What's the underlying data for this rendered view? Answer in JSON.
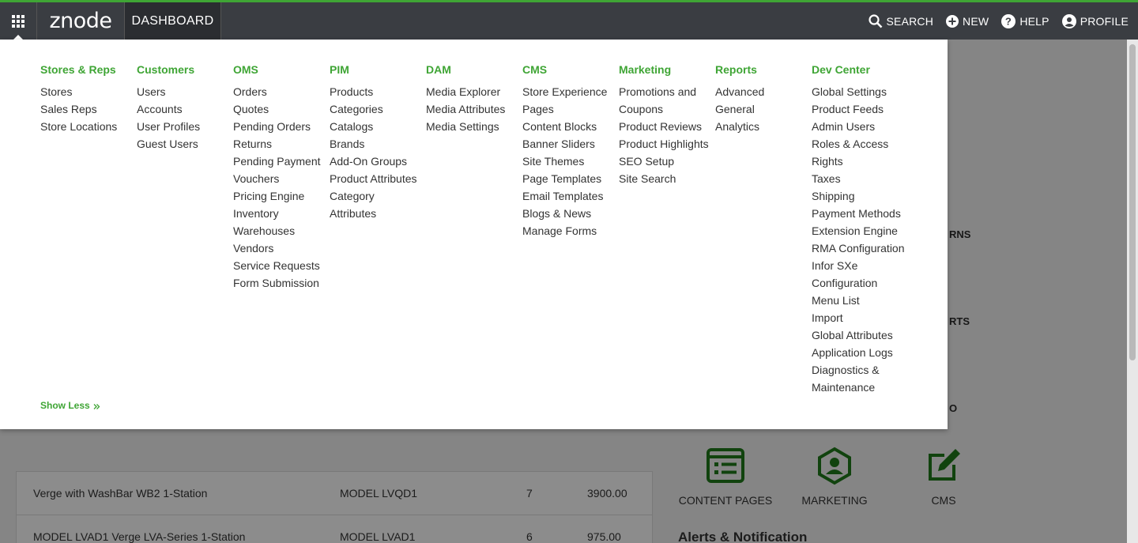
{
  "topbar": {
    "logo": "znode",
    "dashboard_tab": "DASHBOARD",
    "actions": {
      "search": "SEARCH",
      "new": "NEW",
      "help": "HELP",
      "profile": "PROFILE"
    }
  },
  "menu": {
    "columns": [
      {
        "title": "Stores & Reps",
        "items": [
          "Stores",
          "Sales Reps",
          "Store Locations"
        ]
      },
      {
        "title": "Customers",
        "items": [
          "Users",
          "Accounts",
          "User Profiles",
          "Guest Users"
        ]
      },
      {
        "title": "OMS",
        "items": [
          "Orders",
          "Quotes",
          "Pending Orders",
          "Returns",
          "Pending Payment",
          "Vouchers",
          "Pricing Engine",
          "Inventory",
          "Warehouses",
          "Vendors",
          "Service Requests",
          "Form Submission"
        ]
      },
      {
        "title": "PIM",
        "items": [
          "Products",
          "Categories",
          "Catalogs",
          "Brands",
          "Add-On Groups",
          "Product Attributes",
          "Category Attributes"
        ]
      },
      {
        "title": "DAM",
        "items": [
          "Media Explorer",
          "Media Attributes",
          "Media Settings"
        ]
      },
      {
        "title": "CMS",
        "items": [
          "Store Experience Pages",
          "Content Blocks",
          "Banner Sliders",
          "Site Themes",
          "Page Templates",
          "Email Templates",
          "Blogs & News",
          "Manage Forms"
        ]
      },
      {
        "title": "Marketing",
        "items": [
          "Promotions and Coupons",
          "Product Reviews",
          "Product Highlights",
          "SEO Setup",
          "Site Search"
        ]
      },
      {
        "title": "Reports",
        "items": [
          "Advanced General Analytics"
        ]
      },
      {
        "title": "Dev Center",
        "items": [
          "Global Settings",
          "Product Feeds",
          "Admin Users",
          "Roles & Access Rights",
          "Taxes",
          "Shipping",
          "Payment Methods",
          "Extension Engine",
          "RMA Configuration",
          "Infor SXe Configuration",
          "Menu List",
          "Import",
          "Global Attributes",
          "Application Logs",
          "Diagnostics & Maintenance"
        ]
      }
    ],
    "show_less": "Show Less"
  },
  "background": {
    "table_rows": [
      {
        "name": "Verge with WashBar WB2 1-Station",
        "model": "MODEL LVQD1",
        "qty": "7",
        "price": "3900.00"
      },
      {
        "name": "MODEL LVAD1 Verge LVA-Series 1-Station",
        "model": "MODEL LVAD1",
        "qty": "6",
        "price": "975.00"
      }
    ],
    "quick_links": [
      "CONTENT PAGES",
      "MARKETING",
      "CMS"
    ],
    "partial_labels": [
      "RNS",
      "RTS",
      "O"
    ],
    "alerts_title": "Alerts & Notification"
  },
  "colors": {
    "accent_green": "#3fa535",
    "topbar_bg": "#3a3d42",
    "text": "#333333"
  }
}
